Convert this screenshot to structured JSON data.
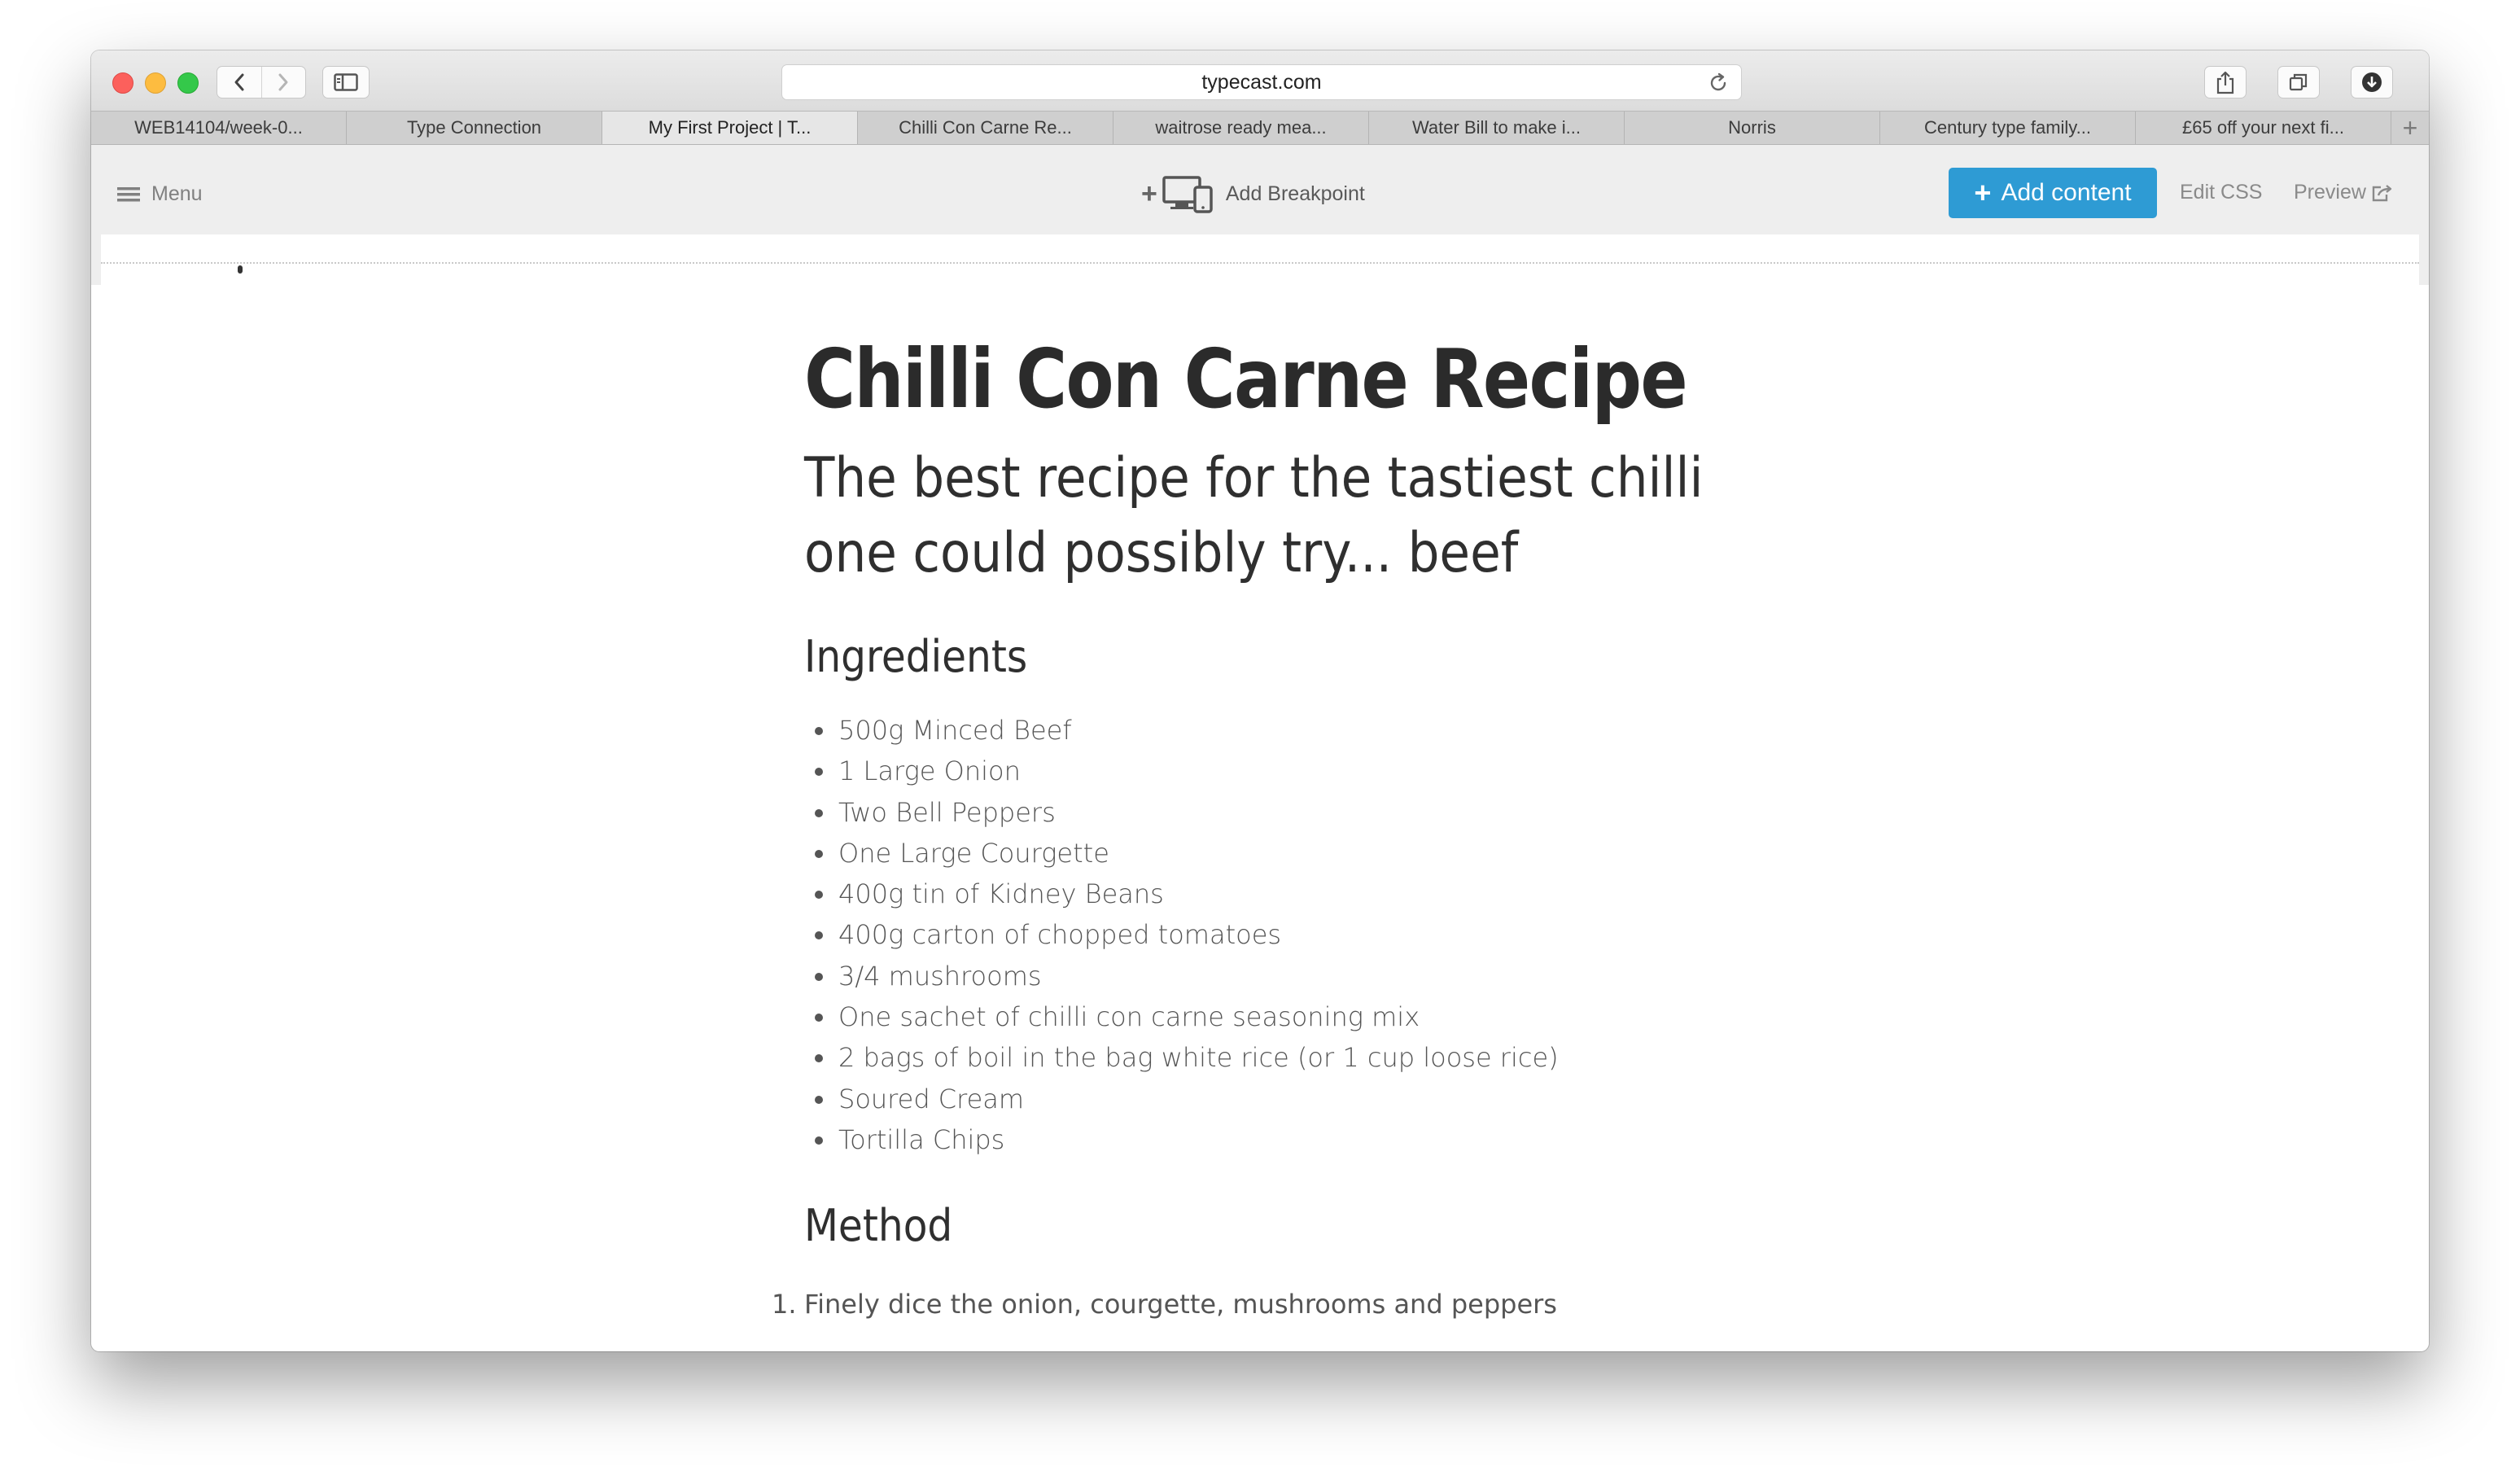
{
  "browser": {
    "url": "typecast.com",
    "tabs": [
      {
        "label": "WEB14104/week-0..."
      },
      {
        "label": "Type Connection"
      },
      {
        "label": "My First Project | T..."
      },
      {
        "label": "Chilli Con Carne Re..."
      },
      {
        "label": "waitrose ready mea..."
      },
      {
        "label": "Water Bill to make i..."
      },
      {
        "label": "Norris"
      },
      {
        "label": "Century type family..."
      },
      {
        "label": "£65 off your next fi..."
      }
    ],
    "active_tab_index": 2,
    "new_tab_symbol": "+",
    "icons": [
      "back-icon",
      "forward-icon",
      "sidebar-icon",
      "reload-icon",
      "share-icon",
      "tabs-icon",
      "download-icon"
    ]
  },
  "appbar": {
    "menu_label": "Menu",
    "add_breakpoint_label": "Add Breakpoint",
    "add_content_label": "Add content",
    "edit_css_label": "Edit CSS",
    "preview_label": "Preview",
    "accent_color": "#2e9bd4"
  },
  "recipe": {
    "title": "Chilli Con Carne Recipe",
    "subtitle": "The best recipe for the tastiest chilli one could possibly try... beef",
    "ingredients_heading": "Ingredients",
    "ingredients": [
      "500g Minced Beef",
      "1 Large Onion",
      "Two Bell Peppers",
      "One Large Courgette",
      "400g tin of Kidney Beans",
      "400g carton of chopped tomatoes",
      "3/4 mushrooms",
      "One sachet of chilli con carne seasoning mix",
      "2 bags of boil in the bag white rice (or 1 cup loose rice)",
      "Soured Cream",
      "Tortilla Chips"
    ],
    "method_heading": "Method",
    "method": [
      {
        "num": "1.",
        "text": "Finely dice the onion, courgette, mushrooms and peppers"
      }
    ]
  }
}
